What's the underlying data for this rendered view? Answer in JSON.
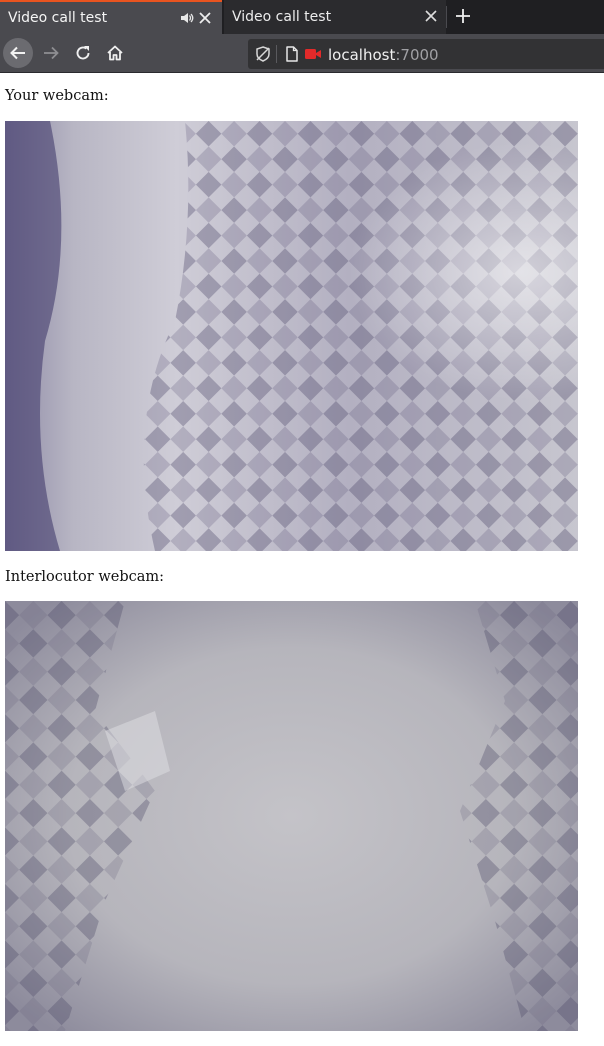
{
  "browser": {
    "tabs": [
      {
        "title": "Video call test",
        "active": true,
        "playing_audio": true
      },
      {
        "title": "Video call test",
        "active": false,
        "playing_audio": false
      }
    ],
    "address": {
      "host": "localhost",
      "port": ":7000"
    },
    "icons": [
      "speaker-icon",
      "close-icon",
      "plus-icon",
      "back-arrow-icon",
      "forward-arrow-icon",
      "reload-icon",
      "home-icon",
      "tracking-protection-icon",
      "page-icon",
      "camera-icon"
    ],
    "accent": "#e95420",
    "camera_indicator_color": "#e22a2a"
  },
  "page": {
    "own_label": "Your webcam:",
    "remote_label": "Interlocutor webcam:"
  }
}
